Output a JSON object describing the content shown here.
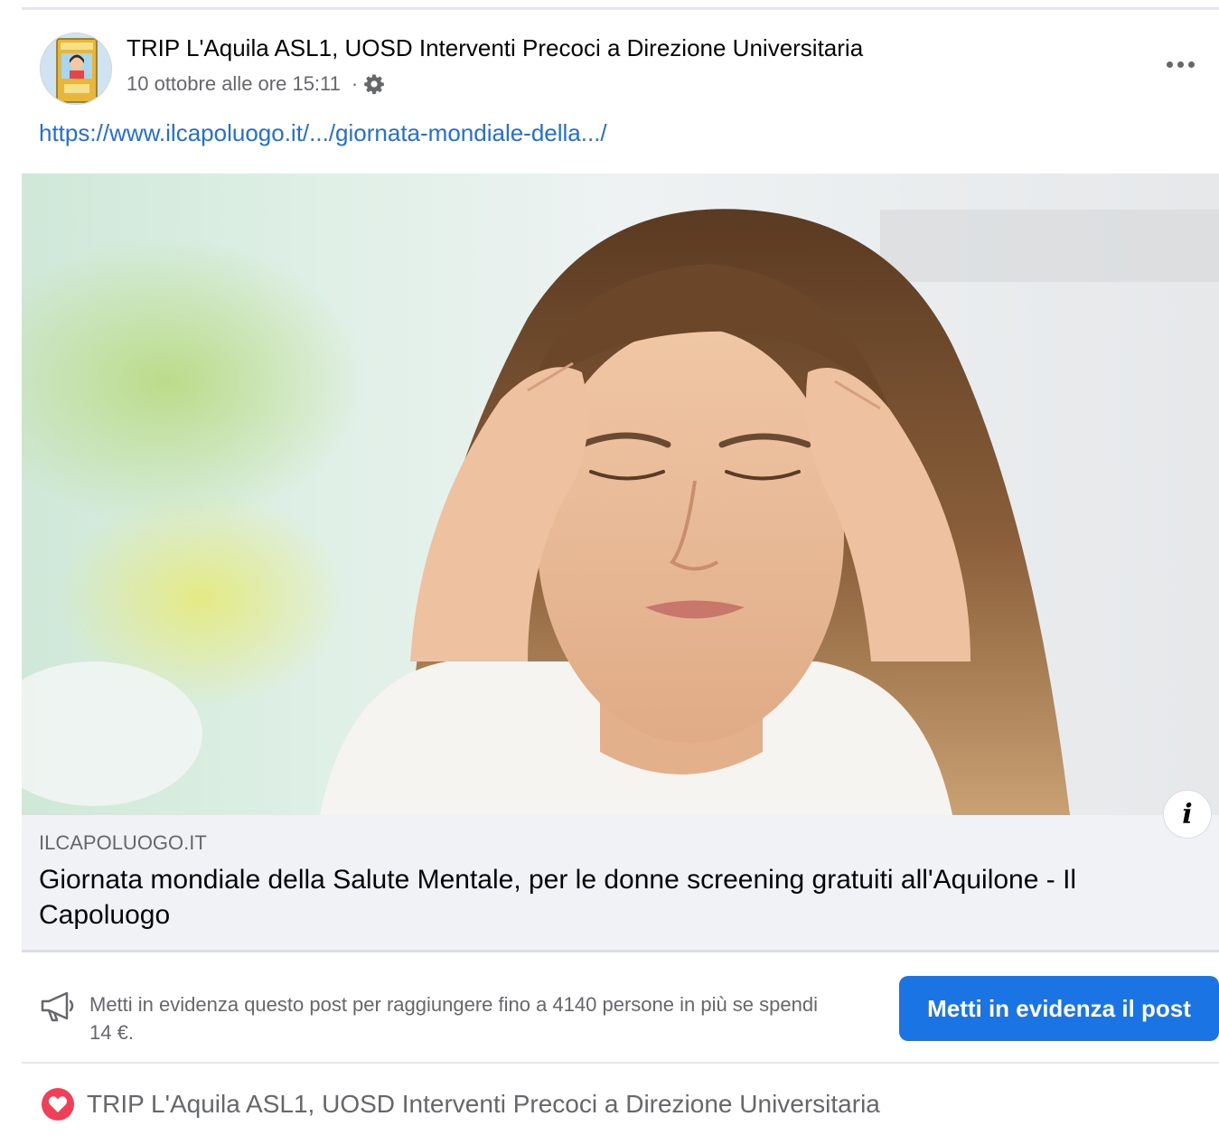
{
  "post": {
    "author": "TRIP L'Aquila ASL1, UOSD Interventi Precoci a Direzione Universitaria",
    "timestamp": "10 ottobre alle ore 15:11",
    "separator": "·",
    "audience_icon": "gear-icon",
    "more_icon": "more-options-icon",
    "link_text": "https://www.ilcapoluogo.it/.../giornata-mondiale-della.../"
  },
  "link_card": {
    "domain": "ILCAPOLUOGO.IT",
    "title": "Giornata mondiale della Salute Mentale, per le donne screening gratuiti all'Aquilone - Il Capoluogo",
    "info_icon": "info-icon"
  },
  "boost": {
    "icon": "megaphone-icon",
    "text": "Metti in evidenza questo post per raggiungere fino a 4140 persone in più se spendi 14 €.",
    "button_label": "Metti in evidenza il post",
    "button_color": "#1b74e4"
  },
  "reactions": {
    "icon": "heart-icon",
    "icon_color": "#f33e58",
    "names": "TRIP L'Aquila ASL1, UOSD Interventi Precoci a Direzione Universitaria"
  },
  "colors": {
    "link": "#216fdb",
    "secondary_text": "#65676b",
    "card_background": "#f0f2f5"
  }
}
